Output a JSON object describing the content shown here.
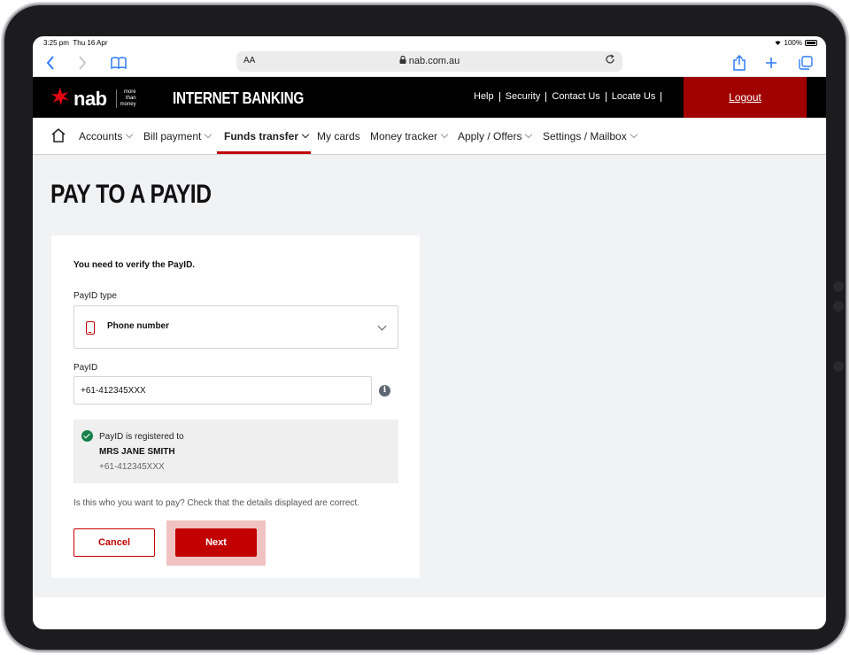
{
  "status_bar": {
    "time": "3:25 pm",
    "date": "Thu 16 Apr",
    "battery": "100%"
  },
  "browser": {
    "text_size": "AA",
    "url": "nab.com.au",
    "icons": [
      "back-icon",
      "forward-icon",
      "bookmarks-icon",
      "lock-icon",
      "reload-icon",
      "share-icon",
      "new-tab-icon",
      "tabs-icon"
    ]
  },
  "header": {
    "logo": "nab",
    "logo_tag": [
      "more",
      "than",
      "money"
    ],
    "app_title": "INTERNET BANKING",
    "links": [
      "Help",
      "Security",
      "Contact Us",
      "Locate Us"
    ],
    "logout_label": "Logout"
  },
  "nav": {
    "items": [
      {
        "label": "Accounts"
      },
      {
        "label": "Bill payment"
      },
      {
        "label": "Funds transfer"
      },
      {
        "label": "My cards"
      },
      {
        "label": "Money tracker"
      },
      {
        "label": "Apply / Offers"
      },
      {
        "label": "Settings / Mailbox"
      }
    ],
    "active": "Funds transfer"
  },
  "page": {
    "title": "PAY TO A PAYID",
    "verify_message": "You need to verify the PayID.",
    "payid_type_label": "PayID type",
    "payid_type_value": "Phone number",
    "payid_label": "PayID",
    "payid_value": "+61-412345XXX",
    "registered_text": "PayID is registered to",
    "registered_name": "MRS JANE SMITH",
    "registered_number": "+61-412345XXX",
    "question": "Is this who you want to pay? Check that the details displayed are correct.",
    "cancel_label": "Cancel",
    "next_label": "Next"
  },
  "colors": {
    "brand_red": "#c20000",
    "logout_bg": "#a10000",
    "success_green": "#168049"
  }
}
